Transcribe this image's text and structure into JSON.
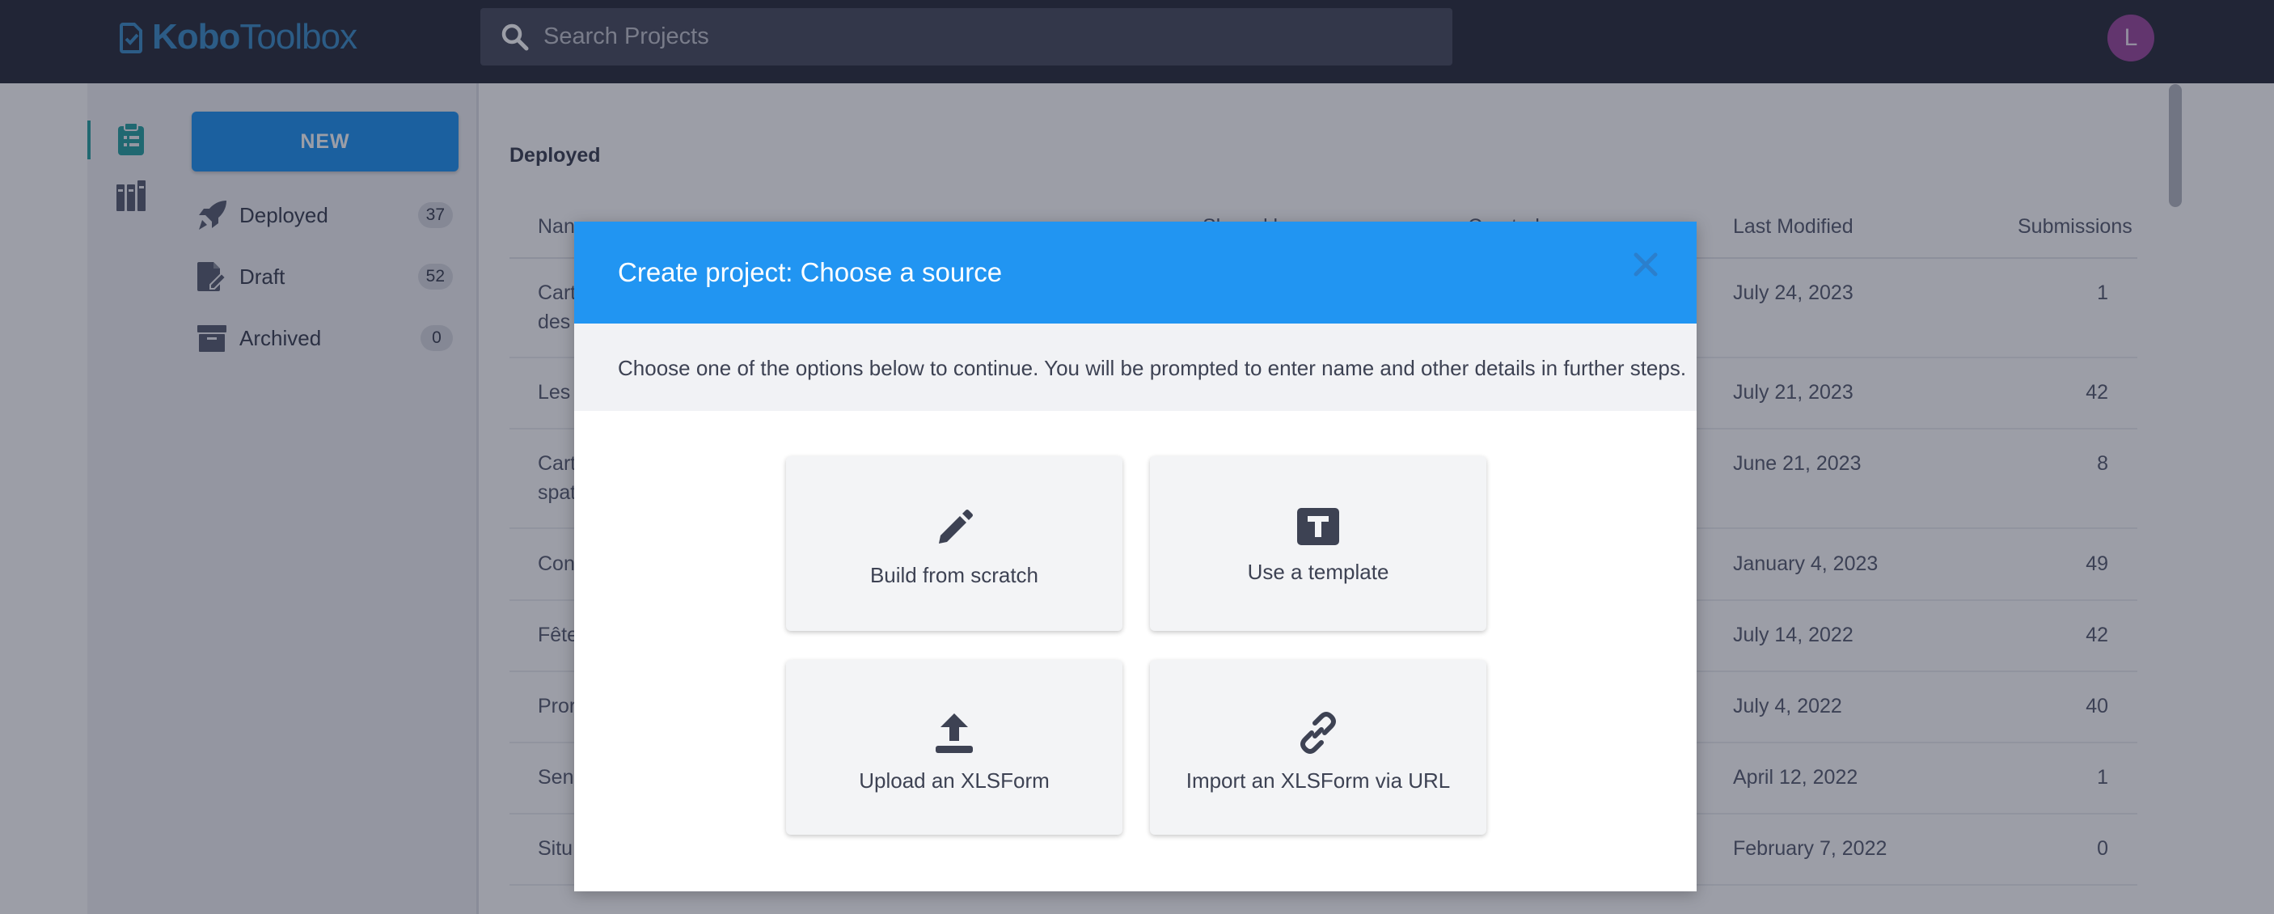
{
  "app": {
    "logo_brand": "KoboToolbox",
    "logo_part1": "Kobo",
    "logo_part2": "Toolbox",
    "search_placeholder": "Search Projects",
    "avatar_initial": "L",
    "accent_color": "#2195f2",
    "topbar_color": "#2b2f3d"
  },
  "sidebar": {
    "new_button": "NEW",
    "items": [
      {
        "label": "Deployed",
        "count": "37",
        "icon": "rocket-icon"
      },
      {
        "label": "Draft",
        "count": "52",
        "icon": "draft-file-icon"
      },
      {
        "label": "Archived",
        "count": "0",
        "icon": "archive-box-icon"
      }
    ],
    "rail_icons": [
      "clipboard-icon",
      "library-icon"
    ]
  },
  "main": {
    "section_title": "Deployed",
    "columns": [
      "Name",
      "Shared by",
      "Created",
      "Last Modified",
      "Submissions"
    ],
    "columns_visible": [
      "Nan",
      "Shared by",
      "Created",
      "Last Modified",
      "Submissions"
    ],
    "rows": [
      {
        "name_line1": "Cart",
        "name_line2": "des",
        "modified": "July 24, 2023",
        "submissions": "1"
      },
      {
        "name_line1": "Les",
        "name_line2": "",
        "modified": "July 21, 2023",
        "submissions": "42"
      },
      {
        "name_line1": "Cart",
        "name_line2": "spat",
        "modified": "June 21, 2023",
        "submissions": "8"
      },
      {
        "name_line1": "Con",
        "name_line2": "",
        "modified": "January 4, 2023",
        "submissions": "49"
      },
      {
        "name_line1": "Fête",
        "name_line2": "",
        "modified": "July 14, 2022",
        "submissions": "42"
      },
      {
        "name_line1": "Pror",
        "name_line2": "",
        "modified": "July 4, 2022",
        "submissions": "40"
      },
      {
        "name_line1": "Sen",
        "name_line2": "",
        "modified": "April 12, 2022",
        "submissions": "1"
      },
      {
        "name_line1": "Situ",
        "name_line2": "",
        "modified": "February 7, 2022",
        "submissions": "0"
      }
    ]
  },
  "modal": {
    "title": "Create project: Choose a source",
    "subtitle": "Choose one of the options below to continue. You will be prompted to enter name and other details in further steps.",
    "options": [
      {
        "label": "Build from scratch",
        "icon": "pencil-icon"
      },
      {
        "label": "Use a template",
        "icon": "template-icon"
      },
      {
        "label": "Upload an XLSForm",
        "icon": "upload-icon"
      },
      {
        "label": "Import an XLSForm via URL",
        "icon": "link-icon"
      }
    ]
  }
}
